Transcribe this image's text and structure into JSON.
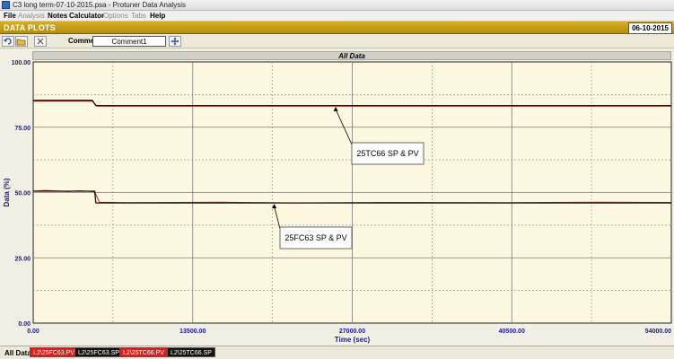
{
  "window": {
    "title": "C3 long term-07-10-2015.psa - Protuner Data Analysis"
  },
  "menu": [
    {
      "label": "File",
      "enabled": true
    },
    {
      "label": "Analysis",
      "enabled": false
    },
    {
      "label": "Notes",
      "enabled": true
    },
    {
      "label": "Calculator",
      "enabled": true
    },
    {
      "label": "Options",
      "enabled": false
    },
    {
      "label": "Tabs",
      "enabled": false
    },
    {
      "label": "Help",
      "enabled": true
    }
  ],
  "header": {
    "title": "DATA PLOTS",
    "date": "06-10-2015"
  },
  "toolbar": {
    "undo_icon": "undo-icon",
    "open_icon": "open-folder-icon",
    "close_icon": "close-x-icon",
    "comment_label": "Comment",
    "comment_value": "Comment1",
    "extra_icon": "move-icon"
  },
  "plot": {
    "title": "All Data"
  },
  "colors": {
    "background": "#fcf9e0",
    "sp_line": "#111111",
    "pv_line": "#cc2222",
    "axis_text": "#1a1a8a",
    "header": "#c59e1a"
  },
  "chart_data": {
    "type": "line",
    "xlabel": "Time (sec)",
    "ylabel": "Data (%)",
    "xlim": [
      0,
      54000
    ],
    "ylim": [
      0,
      100
    ],
    "x_ticks": [
      "0.00",
      "13500.00",
      "27000.00",
      "40500.00",
      "54000.00"
    ],
    "y_ticks": [
      "0.00",
      "25.00",
      "50.00",
      "75.00",
      "100.00"
    ],
    "grid": true,
    "series": [
      {
        "name": "L2\\25FC63.PV",
        "color": "#cc2222",
        "x": [
          0,
          1000,
          3000,
          4000,
          5200,
          5600,
          8000,
          16000,
          22000,
          30000,
          40000,
          48000,
          54000
        ],
        "y": [
          50.5,
          50.8,
          50.4,
          50.7,
          50.3,
          46.3,
          46.1,
          46.3,
          46.0,
          46.2,
          46.1,
          46.3,
          46.2
        ]
      },
      {
        "name": "L2\\25FC63.SP",
        "color": "#111111",
        "x": [
          0,
          5200,
          5300,
          54000
        ],
        "y": [
          50.5,
          50.5,
          46.0,
          46.0
        ]
      },
      {
        "name": "L2\\25TC66.PV",
        "color": "#cc2222",
        "x": [
          0,
          5000,
          5400,
          54000
        ],
        "y": [
          85.0,
          85.0,
          83.1,
          83.1
        ]
      },
      {
        "name": "L2\\25TC66.SP",
        "color": "#111111",
        "x": [
          0,
          5000,
          5300,
          54000
        ],
        "y": [
          85.3,
          85.3,
          83.3,
          83.3
        ]
      }
    ],
    "annotations": [
      {
        "text": "25TC66 SP & PV",
        "x": 25600,
        "y": 83.2
      },
      {
        "text": "25FC63 SP & PV",
        "x": 20400,
        "y": 46.0
      }
    ]
  },
  "tabs": [
    {
      "label": "All Data",
      "style": "active"
    },
    {
      "label": "L2\\25FC63.PV",
      "style": "red"
    },
    {
      "label": "L2\\25FC63.SP",
      "style": "black"
    },
    {
      "label": "L2\\25TC66.PV",
      "style": "red"
    },
    {
      "label": "L2\\25TC66.SP",
      "style": "black"
    }
  ]
}
